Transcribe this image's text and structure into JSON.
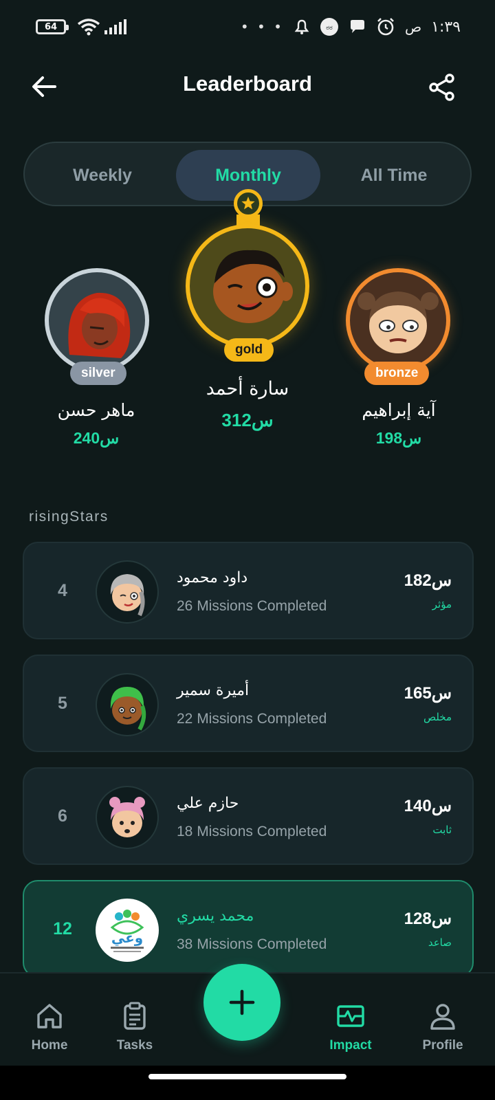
{
  "status_bar": {
    "battery": "64",
    "time": "١:٣٩",
    "ampm": "ص",
    "more": "• • •"
  },
  "header": {
    "title": "Leaderboard"
  },
  "tabs": [
    {
      "label": "Weekly",
      "active": false
    },
    {
      "label": "Monthly",
      "active": true
    },
    {
      "label": "All Time",
      "active": false
    }
  ],
  "podium": {
    "first": {
      "name": "سارة أحمد",
      "points": "312",
      "unit": "س",
      "tier": "gold"
    },
    "second": {
      "name": "ماهر حسن",
      "points": "240",
      "unit": "س",
      "tier": "silver"
    },
    "third": {
      "name": "آية إبراهيم",
      "points": "198",
      "unit": "س",
      "tier": "bronze"
    }
  },
  "rising": {
    "label": "risingStars",
    "rows": [
      {
        "rank": "4",
        "name": "داود محمود",
        "missions": "26 Missions Completed",
        "points": "182",
        "unit": "س",
        "level": "مؤثر"
      },
      {
        "rank": "5",
        "name": "أميرة سمير",
        "missions": "22 Missions Completed",
        "points": "165",
        "unit": "س",
        "level": "مخلص"
      },
      {
        "rank": "6",
        "name": "حازم علي",
        "missions": "18 Missions Completed",
        "points": "140",
        "unit": "س",
        "level": "ثابت"
      },
      {
        "rank": "12",
        "name": "محمد يسري",
        "missions": "38 Missions Completed",
        "points": "128",
        "unit": "س",
        "level": "صاعد",
        "logo_text": "وعي"
      }
    ]
  },
  "nav": [
    {
      "label": "Home",
      "icon": "home-icon",
      "active": false
    },
    {
      "label": "Tasks",
      "icon": "clipboard-icon",
      "active": false
    },
    {
      "label": "Impact",
      "icon": "pulse-icon",
      "active": true
    },
    {
      "label": "Profile",
      "icon": "person-icon",
      "active": false
    }
  ],
  "colors": {
    "background": "#0f1a1a",
    "accent": "#22dba5",
    "gold": "#f5b818",
    "silver": "#c9d4da",
    "bronze": "#f28b2f"
  }
}
